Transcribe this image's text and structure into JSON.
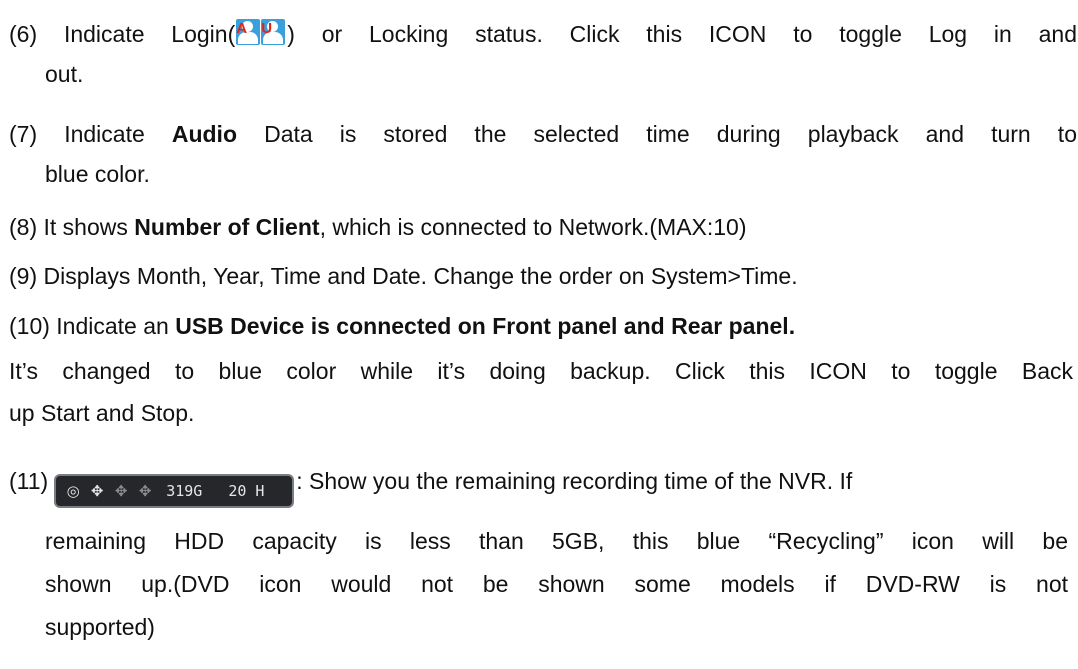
{
  "items": {
    "i6": {
      "num": "(6)",
      "pre": " Indicate Login(",
      "post": ") or Locking status. Click this ICON to toggle Log in and",
      "cont": "out.",
      "icon_letters": [
        "A",
        "U"
      ]
    },
    "i7": {
      "num": "(7)",
      "pre": " Indicate ",
      "bold": "Audio",
      "post": " Data is stored the selected time during playback and turn to",
      "cont": "blue color."
    },
    "i8": {
      "num": "(8)",
      "pre": " It shows ",
      "bold": "Number of Client",
      "post": ", which is connected to Network.(MAX:10)"
    },
    "i9": {
      "num": "(9)",
      "text": " Displays Month, Year, Time and Date. Change the order on System>Time."
    },
    "i10": {
      "num": "(10)",
      "pre": " Indicate an ",
      "bold": "USB Device is connected on Front panel and Rear panel.",
      "cont1": "It’s changed to blue color while it’s doing backup. Click this ICON to toggle Back",
      "cont2": "up Start and Stop."
    },
    "i11": {
      "num": "(11)",
      "post": ": Show you the remaining recording time of the NVR. If",
      "cont1": "remaining HDD capacity is less than 5GB, this blue “Recycling” icon will be",
      "cont2": "shown up.(DVD icon would not be shown some models if DVD-RW is not",
      "cont3": "supported)",
      "status_bar": {
        "storage": "319G",
        "hours": "20 H",
        "icons": [
          "eye-icon",
          "usb-icon",
          "usb-icon",
          "usb-icon"
        ]
      }
    }
  }
}
